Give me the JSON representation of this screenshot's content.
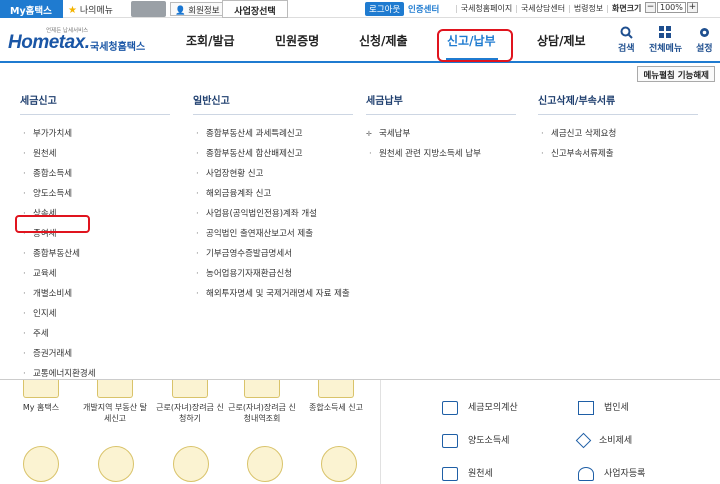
{
  "topbar": {
    "my_hometax": "My홈택스",
    "my_menu": "나의메뉴",
    "member_info": "회원정보",
    "business_select": "사업장선택",
    "logout": "로그아웃",
    "cert_center": "인증센터",
    "links": [
      "국세청홈페이지",
      "국세상담센터",
      "법령정보",
      "화면크기"
    ],
    "zoom_level": "100%"
  },
  "logo": {
    "tagline": "언제든 납세서비스",
    "brand": "Hometax.",
    "name": "국세청홈택스"
  },
  "nav": {
    "items": [
      "조회/발급",
      "민원증명",
      "신청/제출",
      "신고/납부",
      "상담/제보"
    ],
    "active": "신고/납부",
    "tools": [
      "검색",
      "전체메뉴",
      "설정"
    ]
  },
  "mega": {
    "release_button": "메뉴펼침 기능해제",
    "columns": [
      {
        "title": "세금신고",
        "items": [
          "부가가치세",
          "원천세",
          "종합소득세",
          "양도소득세",
          "상속세",
          "증여세",
          "종합부동산세",
          "교육세",
          "개별소비세",
          "인지세",
          "주세",
          "증권거래세",
          "교통에너지환경세"
        ]
      },
      {
        "title": "일반신고",
        "items": [
          "종합부동산세 과세특례신고",
          "종합부동산세 합산배제신고",
          "사업장현황 신고",
          "해외금융계좌 신고",
          "사업용(공익법인전용)계좌 개설",
          "공익법인 출연재산보고서 제출",
          "기부금영수증발급명세서",
          "농어업용기자재환급신청",
          "해외투자명세 및 국제거래명세 자료 제출"
        ]
      },
      {
        "title": "세금납부",
        "items": [
          "국세납부",
          "원천세 관련 지방소득세 납부"
        ]
      },
      {
        "title": "신고삭제/부속서류",
        "items": [
          "세금신고 삭제요청",
          "신고부속서류제출"
        ]
      }
    ]
  },
  "quick_links": [
    "My 홈택스",
    "개발지역 부동산 탈세신고",
    "근로(자녀)장려금 신청하기",
    "근로(자녀)장려금 신청내역조회",
    "종합소득세 신고"
  ],
  "services": [
    "세금모의계산",
    "법인세",
    "양도소득세",
    "소비제세",
    "원천세",
    "사업자등록"
  ],
  "colors": {
    "primary": "#1f7bd0",
    "highlight_box": "#e0141e",
    "nav_text": "#222222"
  }
}
